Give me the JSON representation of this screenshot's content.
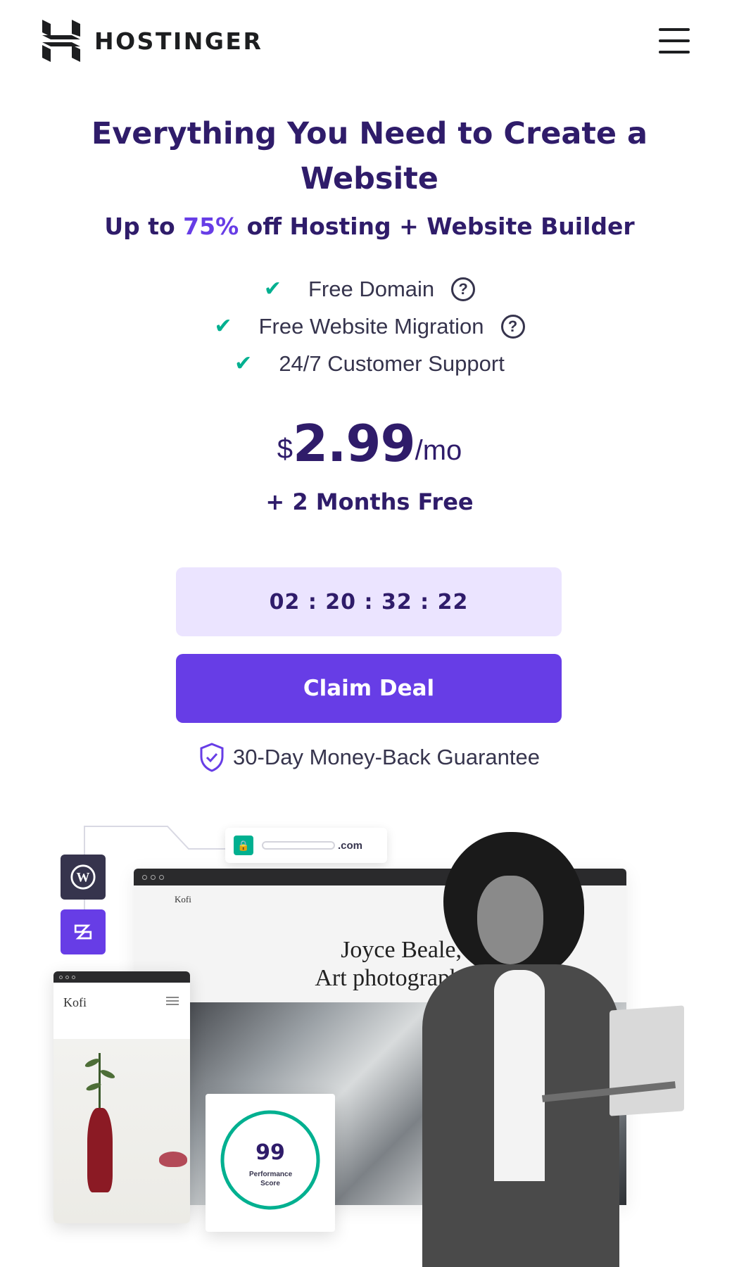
{
  "header": {
    "brand": "HOSTINGER",
    "logo_icon": "hostinger-logo-icon",
    "menu_icon": "hamburger-menu-icon"
  },
  "hero": {
    "headline": "Everything You Need to Create a Website",
    "subhead_prefix": "Up to ",
    "subhead_accent": "75%",
    "subhead_suffix": " off Hosting + Website Builder",
    "accent_color": "#673de6",
    "features": [
      {
        "label": "Free Domain",
        "has_help": true
      },
      {
        "label": "Free Website Migration",
        "has_help": true
      },
      {
        "label": "24/7 Customer Support",
        "has_help": false
      }
    ],
    "check_color": "#00b090"
  },
  "pricing": {
    "currency": "$",
    "amount": "2.99",
    "period": "/mo",
    "bonus": "+ 2 Months Free"
  },
  "timer": {
    "value": "02 : 20 : 32 : 22"
  },
  "cta": {
    "label": "Claim Deal",
    "color": "#673de6"
  },
  "guarantee": {
    "label": "30-Day Money-Back Guarantee",
    "icon": "shield-check-icon"
  },
  "illustration": {
    "url_suffix": ".com",
    "site_name": "Kofi",
    "tagline_line1": "Joyce Beale,",
    "tagline_line2": "Art photograph",
    "mobile_site_name": "Kofi",
    "score_value": "99",
    "score_label_line1": "Performance",
    "score_label_line2": "Score",
    "score_color": "#00b090"
  }
}
